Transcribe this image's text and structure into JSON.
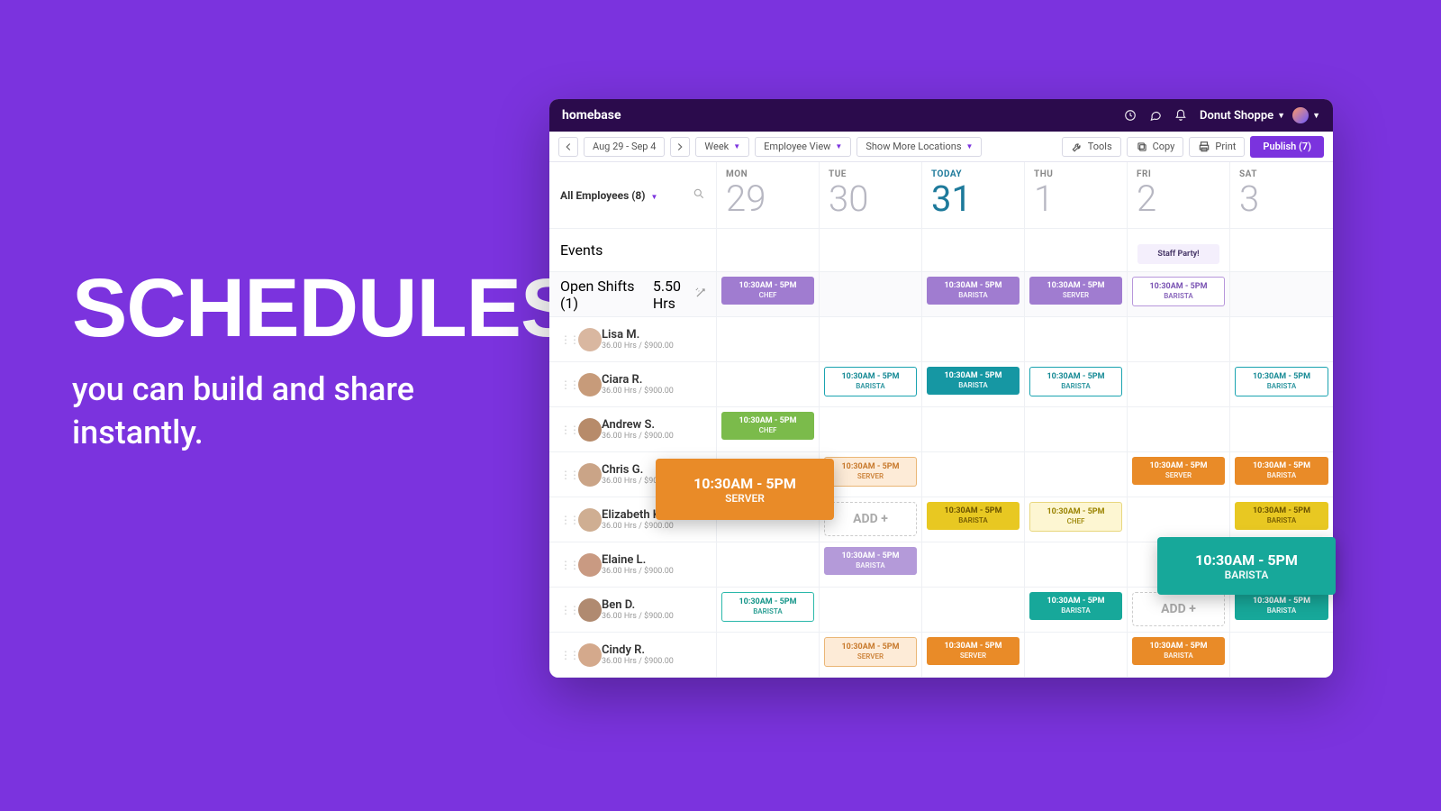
{
  "hero": {
    "title": "SCHEDULES",
    "subtitle": "you can build and share instantly."
  },
  "topbar": {
    "logo": "homebase",
    "shop_name": "Donut Shoppe"
  },
  "toolbar": {
    "date_range": "Aug 29 - Sep 4",
    "view_period": "Week",
    "view_mode": "Employee View",
    "locations": "Show More Locations",
    "tools": "Tools",
    "copy": "Copy",
    "print": "Print",
    "publish": "Publish (7)"
  },
  "filter": {
    "label": "All Employees (8)"
  },
  "days": [
    {
      "dow": "MON",
      "num": "29",
      "today": false
    },
    {
      "dow": "TUE",
      "num": "30",
      "today": false
    },
    {
      "dow": "TODAY",
      "num": "31",
      "today": true
    },
    {
      "dow": "THU",
      "num": "1",
      "today": false
    },
    {
      "dow": "FRI",
      "num": "2",
      "today": false
    },
    {
      "dow": "SAT",
      "num": "3",
      "today": false
    }
  ],
  "events": {
    "label": "Events",
    "items": {
      "4": "Staff Party!"
    }
  },
  "open_shifts": {
    "label": "Open Shifts (1)",
    "sub": "5.50 Hrs",
    "cells": {
      "0": {
        "time": "10:30AM - 5PM",
        "role": "CHEF",
        "cls": "c-purple-solid"
      },
      "2": {
        "time": "10:30AM - 5PM",
        "role": "BARISTA",
        "cls": "c-purple-solid"
      },
      "3": {
        "time": "10:30AM - 5PM",
        "role": "SERVER",
        "cls": "c-purple-solid"
      },
      "4": {
        "time": "10:30AM - 5PM",
        "role": "BARISTA",
        "cls": "c-purple-outline"
      }
    }
  },
  "add_label": "ADD +",
  "employees": [
    {
      "name": "Lisa M.",
      "meta": "36.00 Hrs / $900.00",
      "av": "#d9b7a0",
      "cells": {}
    },
    {
      "name": "Ciara R.",
      "meta": "36.00 Hrs / $900.00",
      "av": "#c79b7a",
      "cells": {
        "1": {
          "time": "10:30AM - 5PM",
          "role": "BARISTA",
          "cls": "c-teal-white"
        },
        "2": {
          "time": "10:30AM - 5PM",
          "role": "BARISTA",
          "cls": "c-teal-solid"
        },
        "3": {
          "time": "10:30AM - 5PM",
          "role": "BARISTA",
          "cls": "c-teal-white"
        },
        "5": {
          "time": "10:30AM - 5PM",
          "role": "BARISTA",
          "cls": "c-teal-white"
        }
      }
    },
    {
      "name": "Andrew S.",
      "meta": "36.00 Hrs / $900.00",
      "av": "#b78b6a",
      "cells": {
        "0": {
          "time": "10:30AM - 5PM",
          "role": "CHEF",
          "cls": "c-green-solid"
        }
      }
    },
    {
      "name": "Chris G.",
      "meta": "36.00 Hrs / $900.00",
      "av": "#caa487",
      "cells": {
        "1": {
          "time": "10:30AM - 5PM",
          "role": "SERVER",
          "cls": "c-orange-cream"
        },
        "4": {
          "time": "10:30AM - 5PM",
          "role": "SERVER",
          "cls": "c-orange-solid"
        },
        "5": {
          "time": "10:30AM - 5PM",
          "role": "BARISTA",
          "cls": "c-orange-solid"
        }
      }
    },
    {
      "name": "Elizabeth K.",
      "meta": "36.00 Hrs / $900.00",
      "av": "#cfae92",
      "cells": {
        "1": {
          "add": true
        },
        "2": {
          "time": "10:30AM - 5PM",
          "role": "BARISTA",
          "cls": "c-yellow-solid"
        },
        "3": {
          "time": "10:30AM - 5PM",
          "role": "CHEF",
          "cls": "c-yellow-light"
        },
        "5": {
          "time": "10:30AM - 5PM",
          "role": "BARISTA",
          "cls": "c-yellow-solid"
        }
      }
    },
    {
      "name": "Elaine L.",
      "meta": "36.00 Hrs / $900.00",
      "av": "#c99a82",
      "cells": {
        "1": {
          "time": "10:30AM - 5PM",
          "role": "BARISTA",
          "cls": "c-lav-solid"
        }
      }
    },
    {
      "name": "Ben D.",
      "meta": "36.00 Hrs / $900.00",
      "av": "#b08a70",
      "cells": {
        "0": {
          "time": "10:30AM - 5PM",
          "role": "BARISTA",
          "cls": "c-teal2-outline"
        },
        "3": {
          "time": "10:30AM - 5PM",
          "role": "BARISTA",
          "cls": "c-teal2-solid"
        },
        "4": {
          "add": true
        },
        "5": {
          "time": "10:30AM - 5PM",
          "role": "BARISTA",
          "cls": "c-teal2-solid"
        }
      }
    },
    {
      "name": "Cindy R.",
      "meta": "36.00 Hrs / $900.00",
      "av": "#d4a98c",
      "cells": {
        "1": {
          "time": "10:30AM - 5PM",
          "role": "SERVER",
          "cls": "c-orange-cream"
        },
        "2": {
          "time": "10:30AM - 5PM",
          "role": "SERVER",
          "cls": "c-orange-solid"
        },
        "4": {
          "time": "10:30AM - 5PM",
          "role": "BARISTA",
          "cls": "c-orange-solid"
        }
      }
    }
  ],
  "float": {
    "orange": {
      "time": "10:30AM - 5PM",
      "role": "SERVER"
    },
    "teal": {
      "time": "10:30AM - 5PM",
      "role": "BARISTA"
    }
  }
}
